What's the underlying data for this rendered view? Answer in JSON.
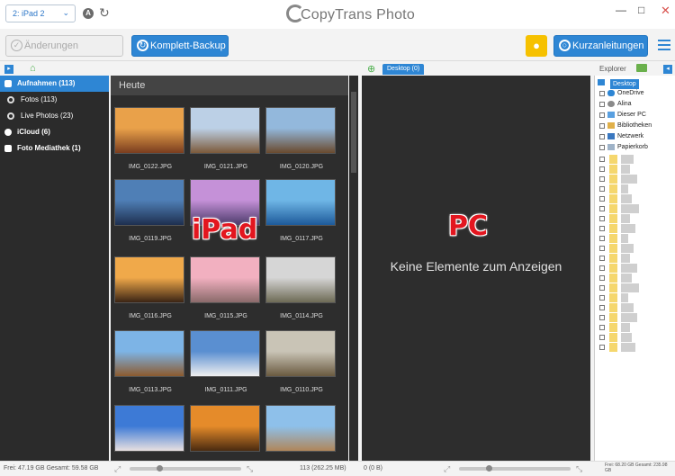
{
  "window": {
    "title": "CopyTrans Photo",
    "device_selected": "2: iPad 2",
    "account_badge": "A"
  },
  "toolbar": {
    "save_label": "Änderungen speichern",
    "backup_label": "Komplett-Backup",
    "guide_label": "Kurzanleitungen"
  },
  "panels": {
    "desktop_tab": "Desktop (0)",
    "explorer_label": "Explorer"
  },
  "sidebar": {
    "items": [
      {
        "label": "Aufnahmen (113)",
        "active": true,
        "sub": false
      },
      {
        "label": "Fotos (113)",
        "active": false,
        "sub": true
      },
      {
        "label": "Live Photos (23)",
        "active": false,
        "sub": true
      },
      {
        "label": "iCloud (6)",
        "active": false,
        "sub": false
      },
      {
        "label": "Foto Mediathek (1)",
        "active": false,
        "sub": false
      }
    ]
  },
  "ipad": {
    "section_header": "Heute",
    "overlay_label": "iPad",
    "photos": [
      {
        "name": "IMG_0122.JPG",
        "colors": [
          "#e9a14a",
          "#7a3d1f"
        ]
      },
      {
        "name": "IMG_0121.JPG",
        "colors": [
          "#bcd0e6",
          "#7c5a3a"
        ]
      },
      {
        "name": "IMG_0120.JPG",
        "colors": [
          "#93b8dc",
          "#6a4a2e"
        ]
      },
      {
        "name": "IMG_0119.JPG",
        "colors": [
          "#4f7fb6",
          "#1e2f4f"
        ]
      },
      {
        "name": "",
        "colors": [
          "#c591d8",
          "#4b3a6a"
        ]
      },
      {
        "name": "IMG_0117.JPG",
        "colors": [
          "#6fb6e6",
          "#1d5a9a"
        ]
      },
      {
        "name": "IMG_0116.JPG",
        "colors": [
          "#f0a94a",
          "#3a2414"
        ]
      },
      {
        "name": "IMG_0115.JPG",
        "colors": [
          "#f2b0c0",
          "#8a6a6a"
        ]
      },
      {
        "name": "IMG_0114.JPG",
        "colors": [
          "#d6d6d6",
          "#6d6a55"
        ]
      },
      {
        "name": "IMG_0113.JPG",
        "colors": [
          "#7db4e6",
          "#8c5a2e"
        ]
      },
      {
        "name": "IMG_0111.JPG",
        "colors": [
          "#5a8fd1",
          "#f0f0f0"
        ]
      },
      {
        "name": "IMG_0110.JPG",
        "colors": [
          "#c9c4b6",
          "#6a5a40"
        ]
      },
      {
        "name": "",
        "colors": [
          "#3d7ad6",
          "#e8e0e0"
        ]
      },
      {
        "name": "",
        "colors": [
          "#e58b2a",
          "#4a2a10"
        ]
      },
      {
        "name": "",
        "colors": [
          "#8ec0ea",
          "#b0865a"
        ]
      }
    ]
  },
  "pc": {
    "overlay_label": "PC",
    "empty_message": "Keine Elemente zum Anzeigen"
  },
  "explorer": {
    "root": "Desktop",
    "items": [
      "OneDrive",
      "Alina",
      "Dieser PC",
      "Bibliotheken",
      "Netzwerk",
      "Papierkorb"
    ]
  },
  "status": {
    "left_disk": "Frei: 47.19 GB Gesamt: 59.58 GB",
    "ipad_count": "113 (262.25 MB)",
    "pc_count": "0 (0 B)",
    "right_disk": "Frei: 68.20 GB Gesamt: 235.98 GB"
  },
  "colors": {
    "accent": "#2e86d4",
    "overlay": "#e3161f",
    "bulb": "#f6c100"
  }
}
